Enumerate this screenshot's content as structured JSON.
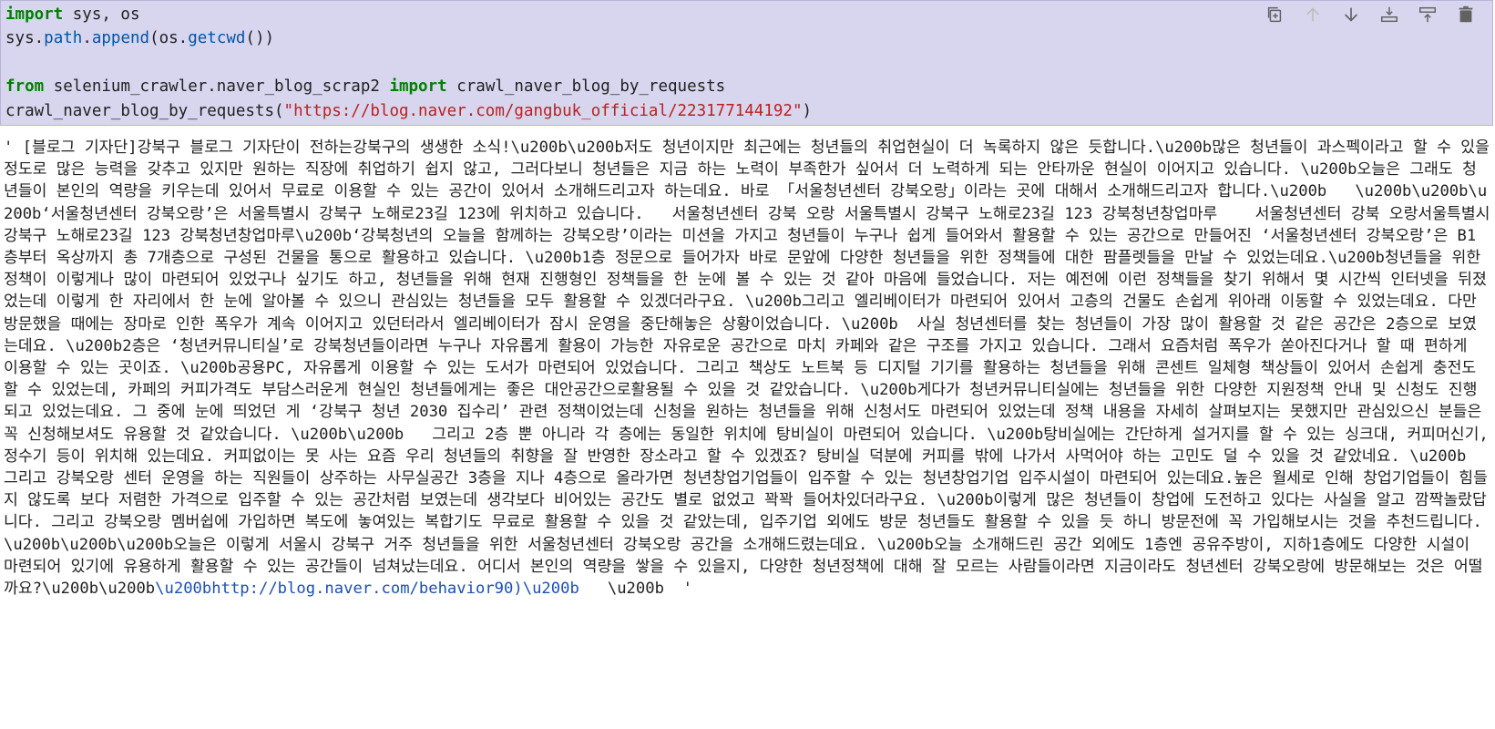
{
  "toolbar": {
    "buttons": [
      {
        "name": "duplicate-cell",
        "icon": "copy-icon"
      },
      {
        "name": "move-up",
        "icon": "arrow-up-icon"
      },
      {
        "name": "move-down",
        "icon": "arrow-down-icon"
      },
      {
        "name": "insert-above",
        "icon": "insert-above-icon"
      },
      {
        "name": "insert-below",
        "icon": "insert-below-icon"
      },
      {
        "name": "delete-cell",
        "icon": "trash-icon"
      }
    ]
  },
  "code": {
    "line1": {
      "kw_import": "import",
      "rest": " sys, os"
    },
    "line2": {
      "a": "sys.",
      "b": "path",
      "c": ".",
      "d": "append",
      "e": "(os.",
      "f": "getcwd",
      "g": "())"
    },
    "line3": "",
    "line4": {
      "kw_from": "from",
      "module": " selenium_crawler.naver_blog_scrap2 ",
      "kw_import": "import",
      "func": " crawl_naver_blog_by_requests"
    },
    "line5": {
      "call": "crawl_naver_blog_by_requests(",
      "url": "\"https://blog.naver.com/gangbuk_official/223177144192\"",
      "close": ")"
    }
  },
  "output": {
    "text": "' [블로그 기자단]강북구 블로그 기자단이 전하는강북구의 생생한 소식!\\u200b\\u200b저도 청년이지만 최근에는 청년들의 취업현실이 더 녹록하지 않은 듯합니다.\\u200b많은 청년들이 과스펙이라고 할 수 있을 정도로 많은 능력을 갖추고 있지만 원하는 직장에 취업하기 쉽지 않고, 그러다보니 청년들은 지금 하는 노력이 부족한가 싶어서 더 노력하게 되는 안타까운 현실이 이어지고 있습니다. \\u200b오늘은 그래도 청년들이 본인의 역량을 키우는데 있어서 무료로 이용할 수 있는 공간이 있어서 소개해드리고자 하는데요. 바로 「서울청년센터 강북오랑」이라는 곳에 대해서 소개해드리고자 합니다.\\u200b   \\u200b\\u200b\\u200b‘서울청년센터 강북오랑’은 서울특별시 강북구 노해로23길 123에 위치하고 있습니다.   서울청년센터 강북 오랑 서울특별시 강북구 노해로23길 123 강북청년창업마루    서울청년센터 강북 오랑서울특별시 강북구 노해로23길 123 강북청년창업마루\\u200b‘강북청년의 오늘을 함께하는 강북오랑’이라는 미션을 가지고 청년들이 누구나 쉽게 들어와서 활용할 수 있는 공간으로 만들어진 ‘서울청년센터 강북오랑’은 B1층부터 옥상까지 총 7개층으로 구성된 건물을 통으로 활용하고 있습니다. \\u200b1층 정문으로 들어가자 바로 문앞에 다양한 청년들을 위한 정책들에 대한 팜플렛들을 만날 수 있었는데요.\\u200b청년들을 위한 정책이 이렇게나 많이 마련되어 있었구나 싶기도 하고, 청년들을 위해 현재 진행형인 정책들을 한 눈에 볼 수 있는 것 같아 마음에 들었습니다. 저는 예전에 이런 정책들을 찾기 위해서 몇 시간씩 인터넷을 뒤졌었는데 이렇게 한 자리에서 한 눈에 알아볼 수 있으니 관심있는 청년들을 모두 활용할 수 있겠더라구요. \\u200b그리고 엘리베이터가 마련되어 있어서 고층의 건물도 손쉽게 위아래 이동할 수 있었는데요. 다만 방문했을 때에는 장마로 인한 폭우가 계속 이어지고 있던터라서 엘리베이터가 잠시 운영을 중단해놓은 상황이었습니다. \\u200b  사실 청년센터를 찾는 청년들이 가장 많이 활용할 것 같은 공간은 2층으로 보였는데요. \\u200b2층은 ‘청년커뮤니티실’로 강북청년들이라면 누구나 자유롭게 활용이 가능한 자유로운 공간으로 마치 카페와 같은 구조를 가지고 있습니다. 그래서 요즘처럼 폭우가 쏟아진다거나 할 때 편하게 이용할 수 있는 곳이죠. \\u200b공용PC, 자유롭게 이용할 수 있는 도서가 마련되어 있었습니다. 그리고 책상도 노트북 등 디지털 기기를 활용하는 청년들을 위해 콘센트 일체형 책상들이 있어서 손쉽게 충전도 할 수 있었는데, 카페의 커피가격도 부담스러운게 현실인 청년들에게는 좋은 대안공간으로활용될 수 있을 것 같았습니다. \\u200b게다가 청년커뮤니티실에는 청년들을 위한 다양한 지원정책 안내 및 신청도 진행되고 있었는데요. 그 중에 눈에 띄었던 게 ‘강북구 청년 2030 집수리’ 관련 정책이었는데 신청을 원하는 청년들을 위해 신청서도 마련되어 있었는데 정책 내용을 자세히 살펴보지는 못했지만 관심있으신 분들은 꼭 신청해보셔도 유용할 것 같았습니다. \\u200b\\u200b   그리고 2층 뿐 아니라 각 층에는 동일한 위치에 탕비실이 마련되어 있습니다. \\u200b탕비실에는 간단하게 설거지를 할 수 있는 싱크대, 커피머신기, 정수기 등이 위치해 있는데요. 커피없이는 못 사는 요즘 우리 청년들의 취향을 잘 반영한 장소라고 할 수 있겠죠? 탕비실 덕분에 커피를 밖에 나가서 사먹어야 하는 고민도 덜 수 있을 것 같았네요. \\u200b   그리고 강북오랑 센터 운영을 하는 직원들이 상주하는 사무실공간 3층을 지나 4층으로 올라가면 청년창업기업들이 입주할 수 있는 청년창업기업 입주시설이 마련되어 있는데요.높은 월세로 인해 창업기업들이 힘들지 않도록 보다 저렴한 가격으로 입주할 수 있는 공간처럼 보였는데 생각보다 비어있는 공간도 별로 없었고 꽉꽉 들어차있더라구요. \\u200b이렇게 많은 청년들이 창업에 도전하고 있다는 사실을 알고 깜짝놀랐답니다. 그리고 강북오랑 멤버쉽에 가입하면 복도에 놓여있는 복합기도 무료로 활용할 수 있을 것 같았는데, 입주기업 외에도 방문 청년들도 활용할 수 있을 듯 하니 방문전에 꼭 가입해보시는 것을 추천드립니다. \\u200b\\u200b\\u200b오늘은 이렇게 서울시 강북구 거주 청년들을 위한 서울청년센터 강북오랑 공간을 소개해드렸는데요. \\u200b오늘 소개해드린 공간 외에도 1층엔 공유주방이, 지하1층에도 다양한 시설이 마련되어 있기에 유용하게 활용할 수 있는 공간들이 넘쳐났는데요. 어디서 본인의 역량을 쌓을 수 있을지, 다양한 청년정책에 대해 잘 모르는 사람들이라면 지금이라도 청년센터 강북오랑에 방문해보는 것은 어떨까요?\\u200b\\u200b",
    "link_tail": "\\u200bhttp://blog.naver.com/behavior90)\\u200b",
    "end": "   \\u200b  '"
  }
}
